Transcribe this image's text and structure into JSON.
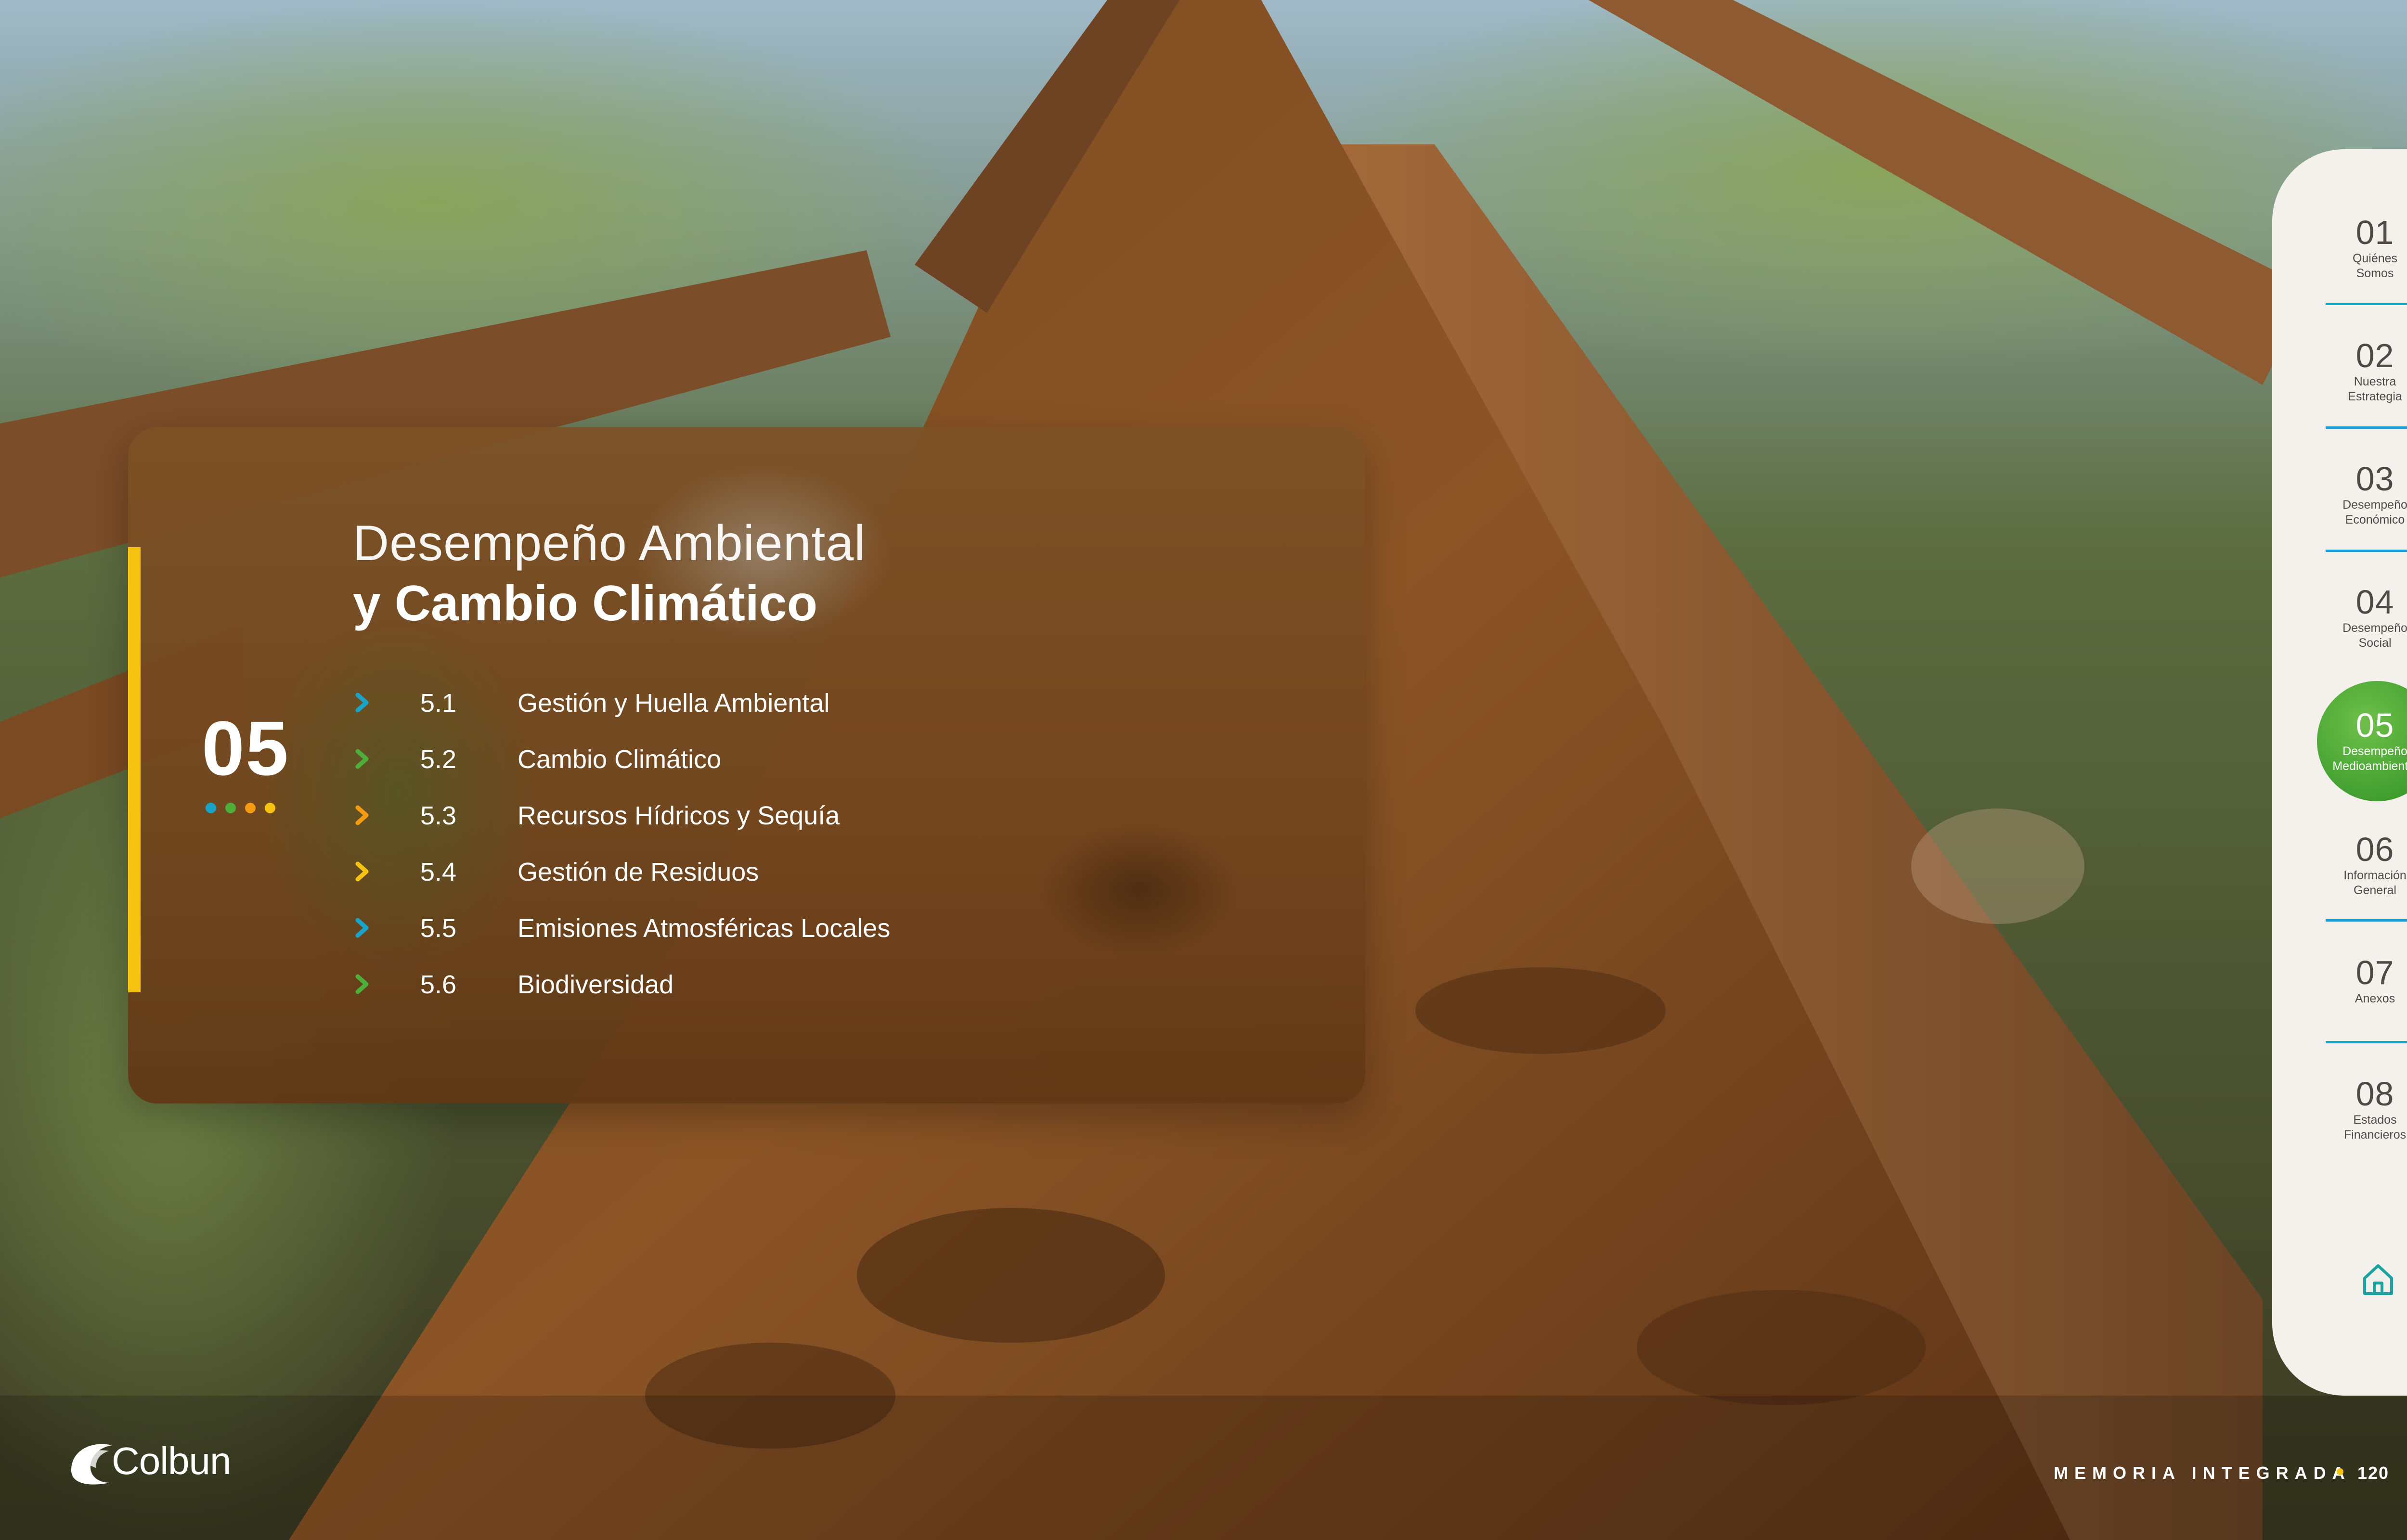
{
  "section": {
    "number": "05",
    "title_line1": "Desempeño Ambiental",
    "title_line2": "y Cambio Climático",
    "accent_color": "#f6c410",
    "dot_colors": [
      "#1aa3c9",
      "#4daf3a",
      "#f39c12",
      "#f6c410"
    ]
  },
  "toc": [
    {
      "num": "5.1",
      "label": "Gestión y Huella Ambiental",
      "color": "#1aa3c9"
    },
    {
      "num": "5.2",
      "label": "Cambio Climático",
      "color": "#4daf3a"
    },
    {
      "num": "5.3",
      "label": "Recursos Hídricos y Sequía",
      "color": "#f39c12"
    },
    {
      "num": "5.4",
      "label": "Gestión de Residuos",
      "color": "#f6c410"
    },
    {
      "num": "5.5",
      "label": "Emisiones Atmosféricas Locales",
      "color": "#1aa3c9"
    },
    {
      "num": "5.6",
      "label": "Biodiversidad",
      "color": "#4daf3a"
    }
  ],
  "nav": [
    {
      "num": "01",
      "line1": "Quiénes",
      "line2": "Somos"
    },
    {
      "num": "02",
      "line1": "Nuestra",
      "line2": "Estrategia"
    },
    {
      "num": "03",
      "line1": "Desempeño",
      "line2": "Económico"
    },
    {
      "num": "04",
      "line1": "Desempeño",
      "line2": "Social"
    },
    {
      "num": "05",
      "line1": "Desempeño",
      "line2": "Medioambiental",
      "active": true
    },
    {
      "num": "06",
      "line1": "Información",
      "line2": "General"
    },
    {
      "num": "07",
      "line1": "Anexos",
      "line2": ""
    },
    {
      "num": "08",
      "line1": "Estados",
      "line2": "Financieros"
    }
  ],
  "nav_style": {
    "separator_color": "#1aa3c9",
    "active_color": "#4daf3a"
  },
  "home_icon": "home-icon",
  "brand": "Colbun",
  "footer": {
    "label": "MEMORIA INTEGRADA",
    "page": "120"
  }
}
